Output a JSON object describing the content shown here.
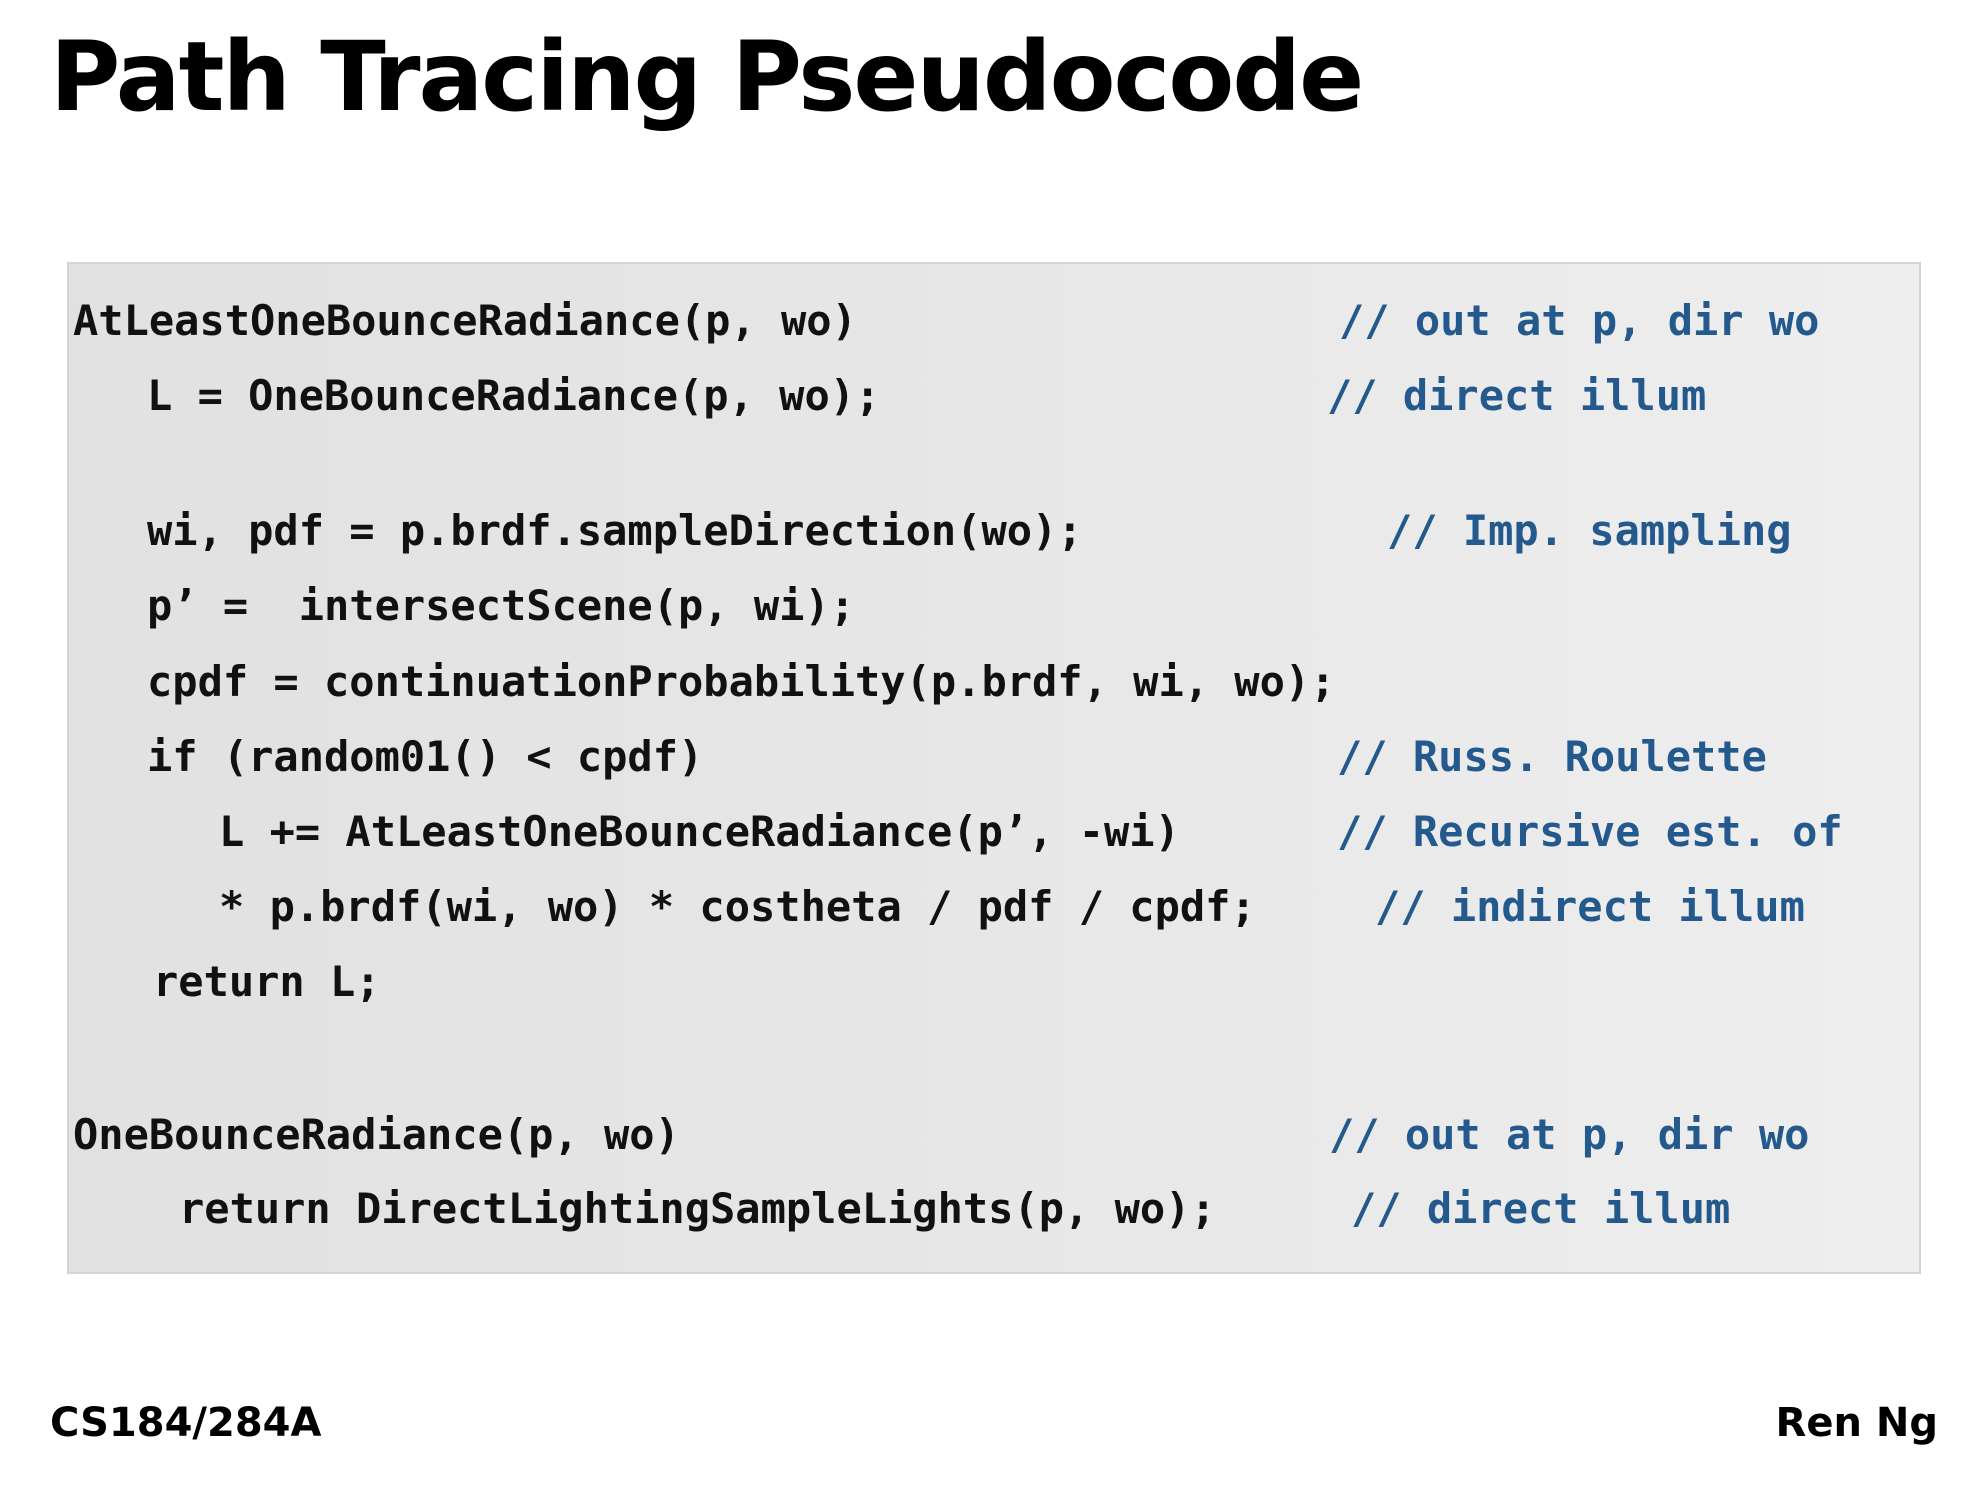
{
  "slide": {
    "title": "Path Tracing Pseudocode"
  },
  "code_block": {
    "lines": [
      {
        "code": "AtLeastOneBounceRadiance(p, wo)",
        "comment": "// out at p, dir wo"
      },
      {
        "code": "L = OneBounceRadiance(p, wo);",
        "comment": "// direct illum"
      },
      {
        "code": "wi, pdf = p.brdf.sampleDirection(wo);",
        "comment": "// Imp. sampling"
      },
      {
        "code": "p’ =  intersectScene(p, wi);",
        "comment": ""
      },
      {
        "code": "cpdf = continuationProbability(p.brdf, wi, wo);",
        "comment": ""
      },
      {
        "code": "if (random01() < cpdf)",
        "comment": "// Russ. Roulette"
      },
      {
        "code": "L += AtLeastOneBounceRadiance(p’, -wi)",
        "comment": "// Recursive est. of"
      },
      {
        "code": "* p.brdf(wi, wo) * costheta / pdf / cpdf;",
        "comment": "// indirect illum"
      },
      {
        "code": "return L;",
        "comment": ""
      },
      {
        "code": "OneBounceRadiance(p, wo)",
        "comment": "// out at p, dir wo"
      },
      {
        "code": "return DirectLightingSampleLights(p, wo);",
        "comment": "// direct illum"
      }
    ]
  },
  "footer": {
    "course": "CS184/284A",
    "author": "Ren Ng"
  },
  "colors": {
    "comment": "#24598d",
    "code": "#111111",
    "box_background": "#e7e7e7"
  }
}
